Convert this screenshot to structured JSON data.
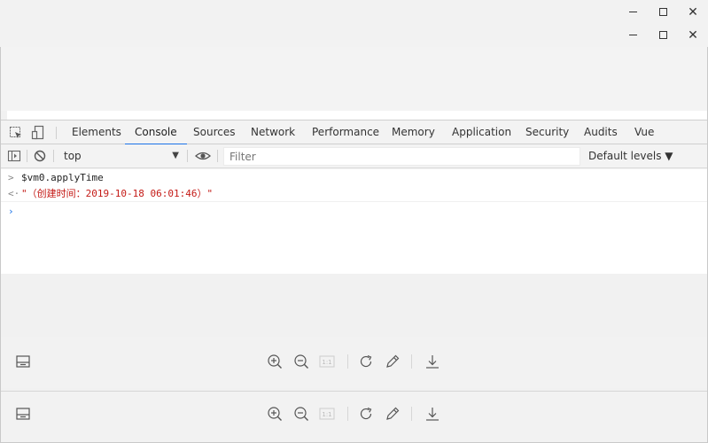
{
  "window": {
    "outer_controls": {
      "minimize": "minimize-icon",
      "maximize": "maximize-icon",
      "close": "close-icon"
    },
    "inner_controls": {
      "minimize": "minimize-icon",
      "maximize": "maximize-icon",
      "close": "close-icon"
    },
    "close_glyph": "✕"
  },
  "devtools": {
    "tabs": [
      {
        "label": "Elements",
        "active": false
      },
      {
        "label": "Console",
        "active": true
      },
      {
        "label": "Sources",
        "active": false
      },
      {
        "label": "Network",
        "active": false
      },
      {
        "label": "Performance",
        "active": false
      },
      {
        "label": "Memory",
        "active": false
      },
      {
        "label": "Application",
        "active": false
      },
      {
        "label": "Security",
        "active": false
      },
      {
        "label": "Audits",
        "active": false
      },
      {
        "label": "Vue",
        "active": false
      }
    ],
    "accent_color": "#1a73e8"
  },
  "console_toolbar": {
    "context": "top",
    "filter_placeholder": "Filter",
    "levels_label": "Default levels ▼"
  },
  "console": {
    "input_command": "$vm0.applyTime",
    "result_quote_open": "\"（创建时间：",
    "result_value": "2019-10-18 06:01:46",
    "result_quote_close": "）\"",
    "string_color": "#c41a16"
  },
  "viewer_toolbar": {
    "zoom_level": "1:1",
    "icons": [
      "panel-icon",
      "zoom-in-icon",
      "zoom-out-icon",
      "actual-size-icon",
      "rotate-icon",
      "edit-icon",
      "download-icon"
    ]
  }
}
